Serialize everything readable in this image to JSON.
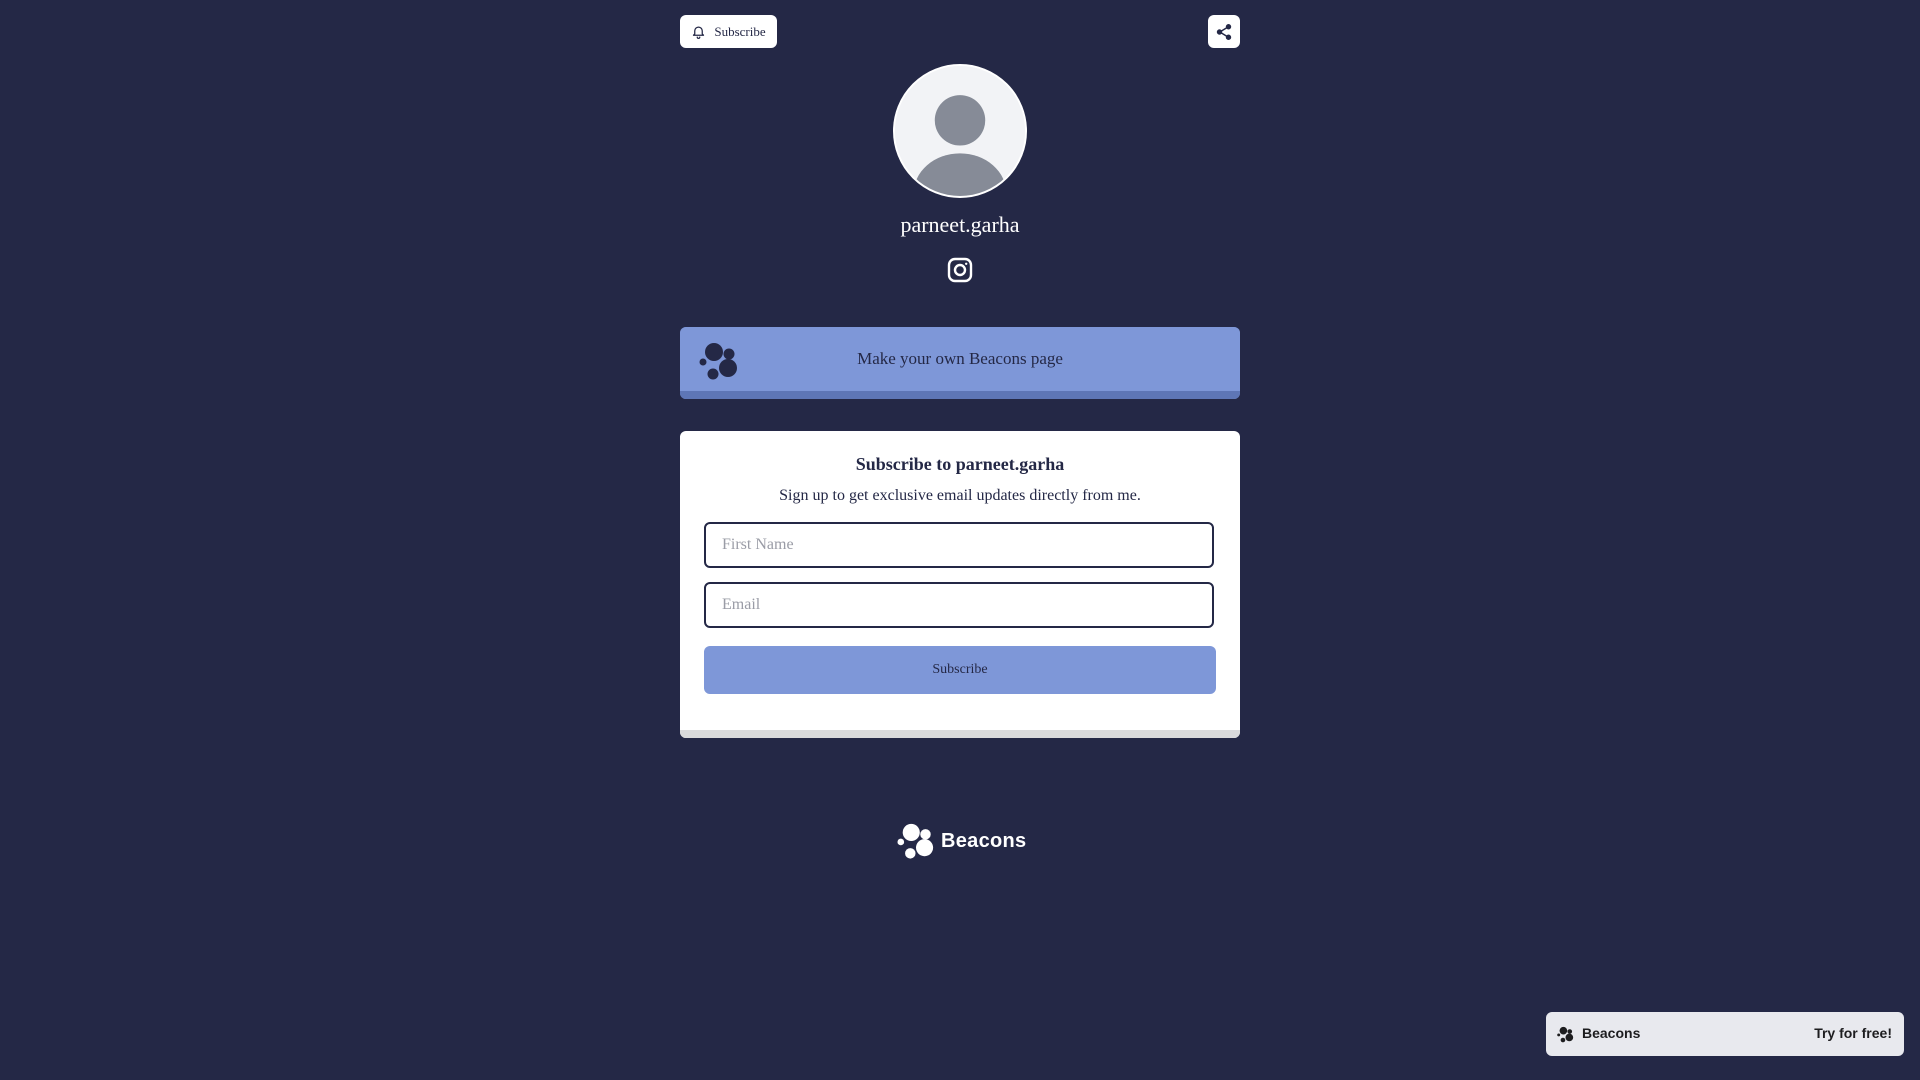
{
  "header": {
    "subscribe_label": "Subscribe"
  },
  "profile": {
    "username": "parneet.garha"
  },
  "banner": {
    "label": "Make your own Beacons page"
  },
  "subscribe_card": {
    "title": "Subscribe to parneet.garha",
    "description": "Sign up to get exclusive email updates directly from me.",
    "first_name_placeholder": "First Name",
    "first_name_value": "",
    "email_placeholder": "Email",
    "email_value": "",
    "button_label": "Subscribe"
  },
  "footer": {
    "brand": "Beacons"
  },
  "promo_bar": {
    "brand": "Beacons",
    "cta": "Try for free!"
  },
  "icons": {
    "bell": "bell-icon",
    "share": "share-icon",
    "avatar": "user-avatar-icon",
    "instagram": "instagram-icon",
    "beacons": "beacons-logo-icon"
  },
  "colors": {
    "background": "#242846",
    "accent": "#7e97d8",
    "card": "#ffffff"
  }
}
